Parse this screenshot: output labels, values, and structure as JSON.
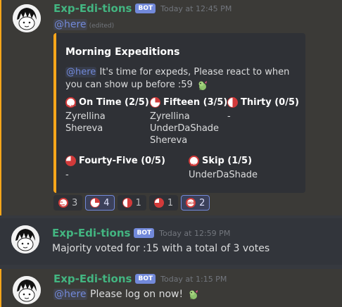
{
  "messages": [
    {
      "username": "Exp-Edi-tions",
      "bot_tag": "BOT",
      "timestamp": "Today at 12:45 PM",
      "mention": "@here",
      "edited": "(edited)",
      "embed": {
        "color": "#faa61a",
        "title": "Morning Expeditions",
        "mention": "@here",
        "description": "It's time for expeds, Please react to when you can show up before :59",
        "fields": [
          {
            "name": "On Time (2/5)",
            "icon": "on-time-icon",
            "values": [
              "Zyrellina",
              "Shereva"
            ]
          },
          {
            "name": "Fifteen (3/5)",
            "icon": "clock-quarter-icon",
            "values": [
              "Zyrellina",
              "UnderDaShade",
              "Shereva"
            ]
          },
          {
            "name": "Thirty (0/5)",
            "icon": "clock-half-icon",
            "values": [
              "-"
            ]
          },
          {
            "name": "Fourty-Five (0/5)",
            "icon": "clock-three-quarter-icon",
            "values": [
              "-"
            ]
          },
          {
            "name": "Skip (1/5)",
            "icon": "skip-icon",
            "values": [
              "UnderDaShade"
            ]
          }
        ]
      },
      "reactions": [
        {
          "icon": "on-time-icon",
          "count": "3",
          "me": false
        },
        {
          "icon": "clock-quarter-icon",
          "count": "4",
          "me": true
        },
        {
          "icon": "clock-half-icon",
          "count": "1",
          "me": false
        },
        {
          "icon": "clock-three-quarter-icon",
          "count": "1",
          "me": false
        },
        {
          "icon": "skip-icon",
          "count": "2",
          "me": true
        }
      ]
    },
    {
      "username": "Exp-Edi-tions",
      "bot_tag": "BOT",
      "timestamp": "Today at 12:59 PM",
      "content": "Majority voted for :15 with a total of 3 votes"
    },
    {
      "username": "Exp-Edi-tions",
      "bot_tag": "BOT",
      "timestamp": "Today at 1:15 PM",
      "mention": "@here",
      "content": "Please log on now!"
    }
  ],
  "colors": {
    "background": "#36393f",
    "username": "#43b581",
    "bot_badge": "#7289da",
    "mention": "#7289da",
    "embed_bg": "#2f3136",
    "highlight_border": "#faa61a"
  }
}
